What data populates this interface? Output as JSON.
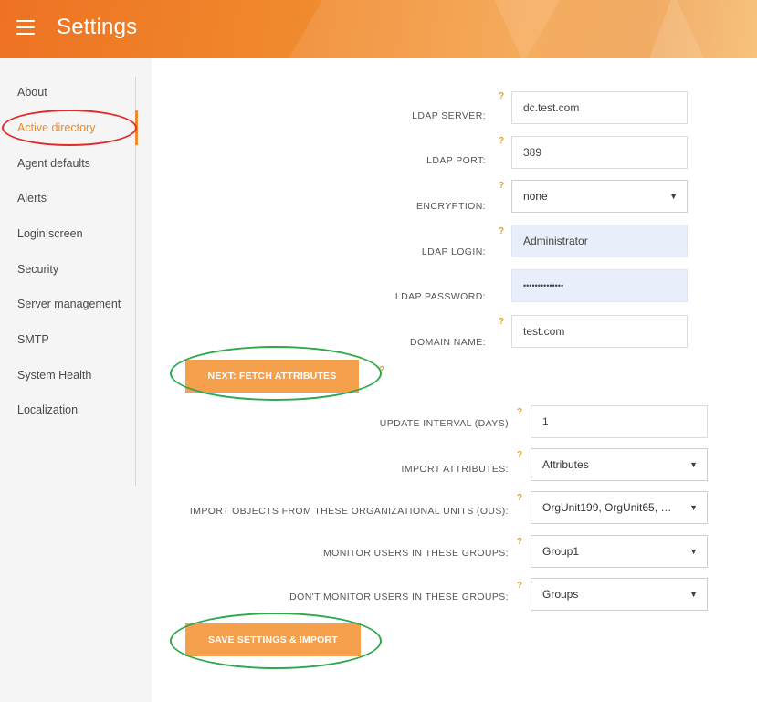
{
  "header": {
    "title": "Settings"
  },
  "sidebar": {
    "items": [
      {
        "label": "About"
      },
      {
        "label": "Active directory"
      },
      {
        "label": "Agent defaults"
      },
      {
        "label": "Alerts"
      },
      {
        "label": "Login screen"
      },
      {
        "label": "Security"
      },
      {
        "label": "Server management"
      },
      {
        "label": "SMTP"
      },
      {
        "label": "System Health"
      },
      {
        "label": "Localization"
      }
    ]
  },
  "form": {
    "help_glyph": "?",
    "ldap_server": {
      "label": "LDAP SERVER:",
      "value": "dc.test.com"
    },
    "ldap_port": {
      "label": "LDAP PORT:",
      "value": "389"
    },
    "encryption": {
      "label": "ENCRYPTION:",
      "value": "none"
    },
    "ldap_login": {
      "label": "LDAP LOGIN:",
      "value": "Administrator"
    },
    "ldap_password": {
      "label": "LDAP PASSWORD:",
      "value": "••••••••••••••"
    },
    "domain_name": {
      "label": "DOMAIN NAME:",
      "value": "test.com"
    },
    "fetch_button": "NEXT: FETCH ATTRIBUTES",
    "update_interval": {
      "label": "UPDATE INTERVAL (DAYS)",
      "value": "1"
    },
    "import_attributes": {
      "label": "IMPORT ATTRIBUTES:",
      "value": "Attributes"
    },
    "import_ous": {
      "label": "IMPORT OBJECTS FROM THESE ORGANIZATIONAL UNITS (OUS):",
      "value": "OrgUnit199, OrgUnit65, Or..."
    },
    "monitor_groups": {
      "label": "MONITOR USERS IN THESE GROUPS:",
      "value": "Group1"
    },
    "dont_monitor_groups": {
      "label": "DON'T MONITOR USERS IN THESE GROUPS:",
      "value": "Groups"
    },
    "save_button": "SAVE SETTINGS & IMPORT"
  },
  "colors": {
    "accent": "#f08a2e",
    "button": "#f5a04d",
    "highlight_red": "#e02a2a",
    "highlight_green": "#2ea84a"
  },
  "icons": {
    "menu": "hamburger-icon",
    "help": "question-icon",
    "dropdown": "caret-down-icon"
  }
}
